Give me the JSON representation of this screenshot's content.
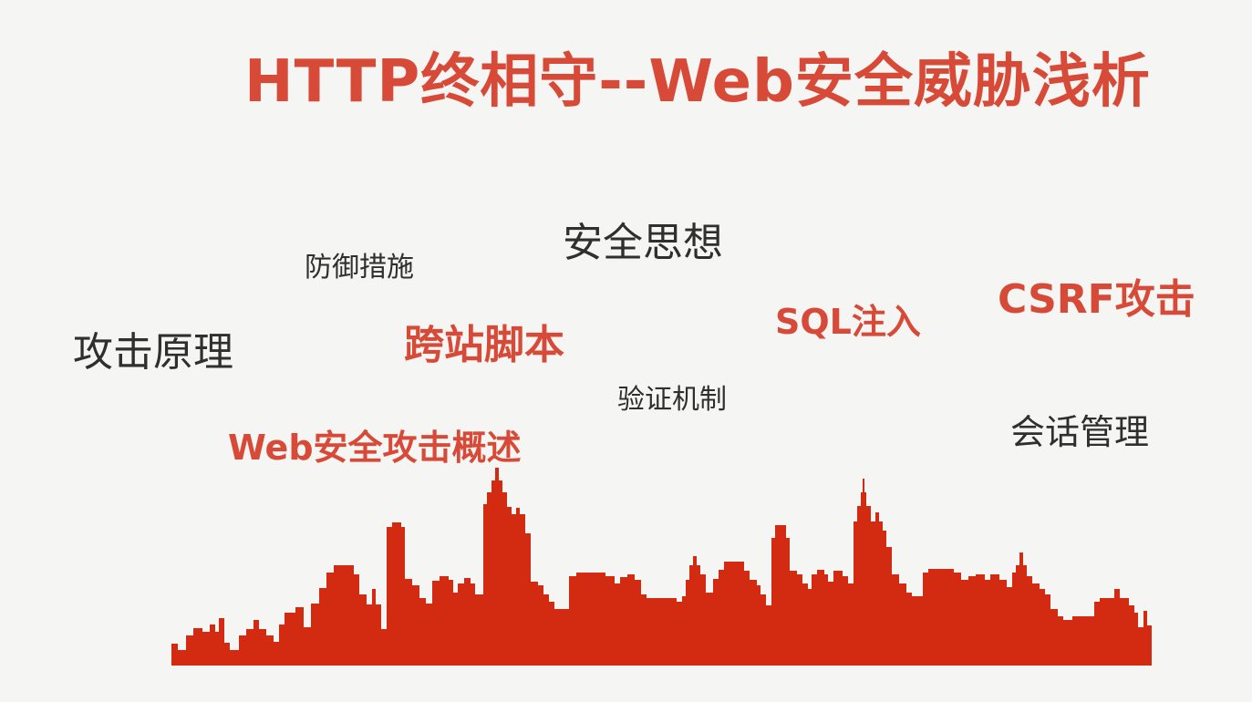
{
  "title": "HTTP终相守--Web安全威胁浅析",
  "keywords": {
    "security_thinking": "安全思想",
    "defense_measures": "防御措施",
    "csrf_attack": "CSRF攻击",
    "sql_injection": "SQL注入",
    "attack_principle": "攻击原理",
    "xss": "跨站脚本",
    "auth_mechanism": "验证机制",
    "session_management": "会话管理",
    "web_attack_overview": "Web安全攻击概述"
  },
  "colors": {
    "accent": "#d84a38",
    "skyline": "#d32a12",
    "text_gray": "#2f2f2f",
    "background": "#f5f5f3"
  }
}
